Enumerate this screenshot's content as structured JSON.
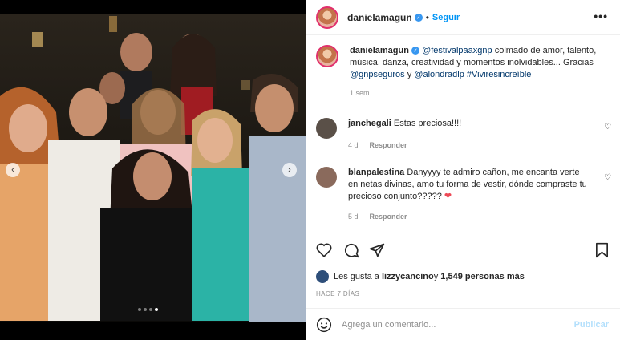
{
  "post": {
    "author": "danielamagun",
    "follow_label": "Seguir",
    "more_label": "•••",
    "photo_slide_active": 4,
    "photo_slide_total": 4
  },
  "caption": {
    "username": "danielamagun",
    "mention_1": "@festivalpaaxgnp",
    "text_1": " colmado de amor, talento, música, danza, creatividad y momentos inolvidables... Gracias ",
    "mention_2": "@gnpseguros",
    "text_2": " y ",
    "mention_3": "@alondradlp",
    "hashtag": "#Viviresincreíble",
    "time": "1 sem"
  },
  "comments": [
    {
      "username": "janchegali",
      "text": "Estas preciosa!!!!",
      "time": "4 d",
      "reply": "Responder",
      "avatar_color": "#5a5048"
    },
    {
      "username": "blanpalestina",
      "text": "Danyyyy te admiro cañon, me encanta verte en netas divinas, amo tu forma de vestir, dónde compraste tu precioso conjunto?????",
      "time": "5 d",
      "reply": "Responder",
      "avatar_color": "#8a6a5c"
    }
  ],
  "likes": {
    "prefix": "Les gusta a ",
    "user": "lizzycancino",
    "mid": " y ",
    "count": "1,549 personas más"
  },
  "posted_ago": "HACE 7 DÍAS",
  "add_comment": {
    "placeholder": "Agrega un comentario...",
    "publish": "Publicar"
  },
  "colors": {
    "accent": "#0095f6",
    "heart": "#ed4956",
    "link": "#00376b"
  }
}
